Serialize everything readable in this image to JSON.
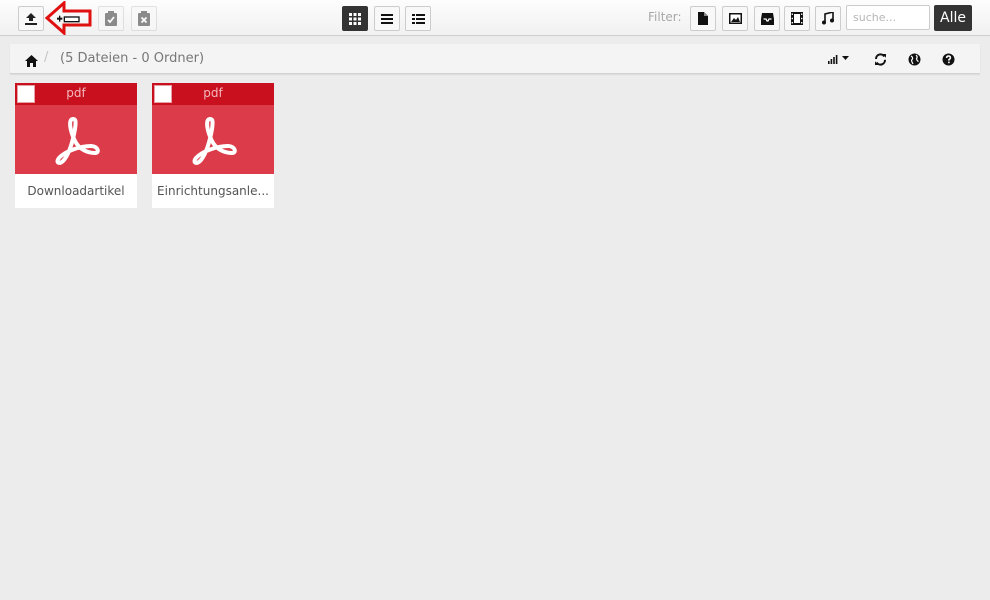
{
  "toolbar": {
    "left_buttons": [
      {
        "icon": "upload-icon"
      },
      {
        "icon": "new-folder-icon"
      },
      {
        "icon": "paste-icon"
      },
      {
        "icon": "clear-clipboard-icon"
      }
    ],
    "view_buttons": [
      {
        "icon": "grid-view-icon",
        "active": true
      },
      {
        "icon": "list-view-icon",
        "active": false
      },
      {
        "icon": "columns-view-icon",
        "active": false
      }
    ],
    "filter_label": "Filter:",
    "filter_buttons": [
      {
        "icon": "file-icon"
      },
      {
        "icon": "image-icon"
      },
      {
        "icon": "archive-icon"
      },
      {
        "icon": "video-icon"
      },
      {
        "icon": "music-icon"
      }
    ],
    "search_placeholder": "suche...",
    "search_value": "",
    "all_button_label": "Alle"
  },
  "breadcrumb": {
    "home_icon": "home-icon",
    "separator": "/",
    "summary": "(5 Dateien - 0 Ordner)",
    "actions": [
      "sort-icon",
      "refresh-icon",
      "language-icon",
      "help-icon"
    ]
  },
  "files": [
    {
      "ext": "pdf",
      "name": "Downloadartikel",
      "icon": "pdf-icon"
    },
    {
      "ext": "pdf",
      "name": "Einrichtungsanle...",
      "icon": "pdf-icon"
    }
  ],
  "colors": {
    "accent_dark": "#333333",
    "pdf_header": "#c8101e",
    "pdf_body": "#dc3c4a",
    "annotation_arrow": "#e01010"
  }
}
